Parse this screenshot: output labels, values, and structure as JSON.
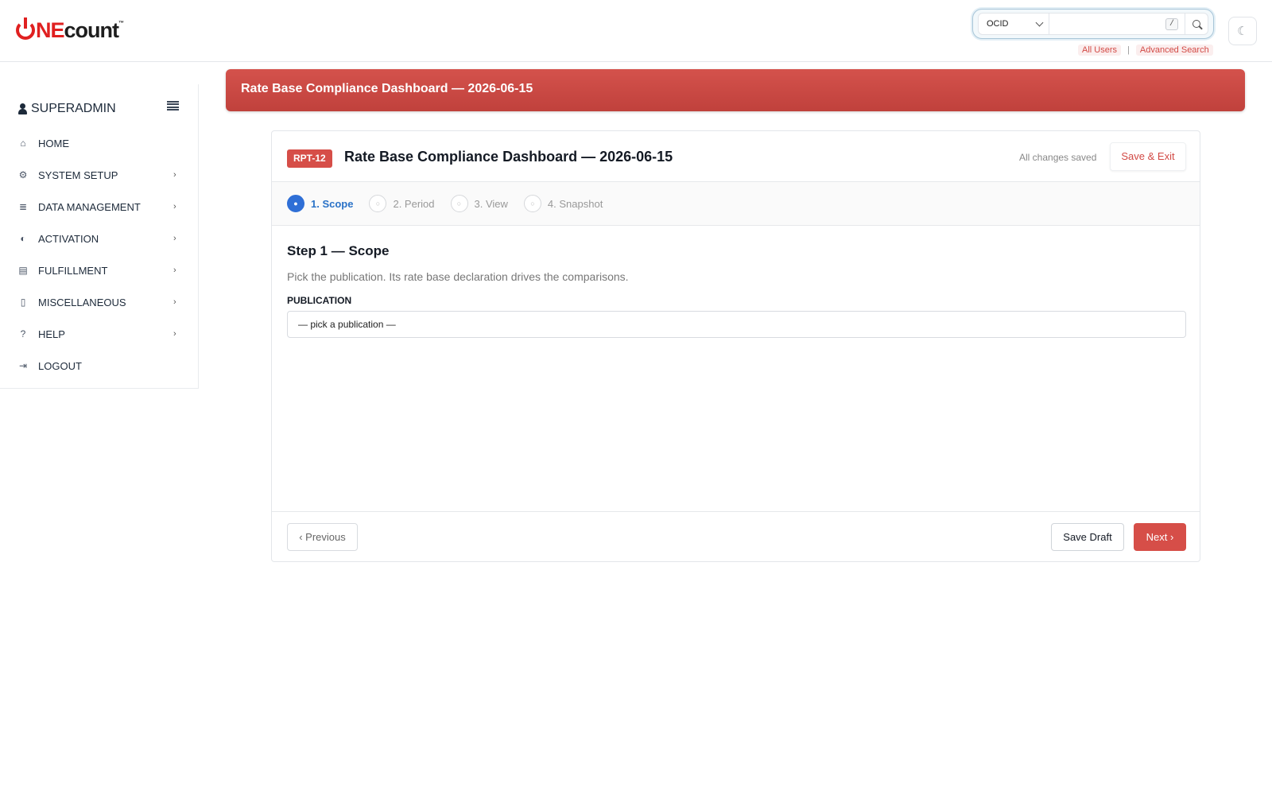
{
  "header": {
    "logo_prefix": "NE",
    "logo_suffix": "count",
    "logo_tm": "™",
    "search": {
      "selected_type": "OCID",
      "value": "",
      "shortcut_key": "/"
    },
    "links": {
      "all_users": "All Users",
      "separator": "|",
      "advanced_search": "Advanced Search"
    },
    "theme_icon": "☾"
  },
  "sidebar": {
    "user": "SUPERADMIN",
    "items": [
      {
        "label": "HOME",
        "icon": "home-icon",
        "glyph": "⌂",
        "has_arrow": false
      },
      {
        "label": "SYSTEM SETUP",
        "icon": "gear-icon",
        "glyph": "⚙",
        "has_arrow": true
      },
      {
        "label": "DATA MANAGEMENT",
        "icon": "database-icon",
        "glyph": "≣",
        "has_arrow": true
      },
      {
        "label": "ACTIVATION",
        "icon": "toggle-icon",
        "glyph": "◐",
        "has_arrow": true
      },
      {
        "label": "FULFILLMENT",
        "icon": "newspaper-icon",
        "glyph": "▤",
        "has_arrow": true
      },
      {
        "label": "MISCELLANEOUS",
        "icon": "file-icon",
        "glyph": "▯",
        "has_arrow": true
      },
      {
        "label": "HELP",
        "icon": "question-icon",
        "glyph": "?",
        "has_arrow": true
      },
      {
        "label": "LOGOUT",
        "icon": "logout-icon",
        "glyph": "⇥",
        "has_arrow": false
      }
    ],
    "arrow_glyph": "›"
  },
  "banner": {
    "title": "Rate Base Compliance Dashboard — 2026-06-15"
  },
  "card": {
    "badge": "RPT-12",
    "title": "Rate Base Compliance Dashboard — 2026-06-15",
    "status": "All changes saved",
    "save_exit": "Save & Exit",
    "steps": [
      {
        "label": "1. Scope",
        "active": true,
        "glyph": "●"
      },
      {
        "label": "2. Period",
        "active": false,
        "glyph": "○"
      },
      {
        "label": "3. View",
        "active": false,
        "glyph": "○"
      },
      {
        "label": "4. Snapshot",
        "active": false,
        "glyph": "○"
      }
    ],
    "step_title": "Step 1 — Scope",
    "step_desc": "Pick the publication. Its rate base declaration drives the comparisons.",
    "field_label": "PUBLICATION",
    "field_value": "— pick a publication —",
    "prev": "‹ Previous",
    "save_draft": "Save Draft",
    "next": "Next ›"
  },
  "colors": {
    "brand_red": "#d64e48",
    "active_blue": "#2f6fd6"
  }
}
